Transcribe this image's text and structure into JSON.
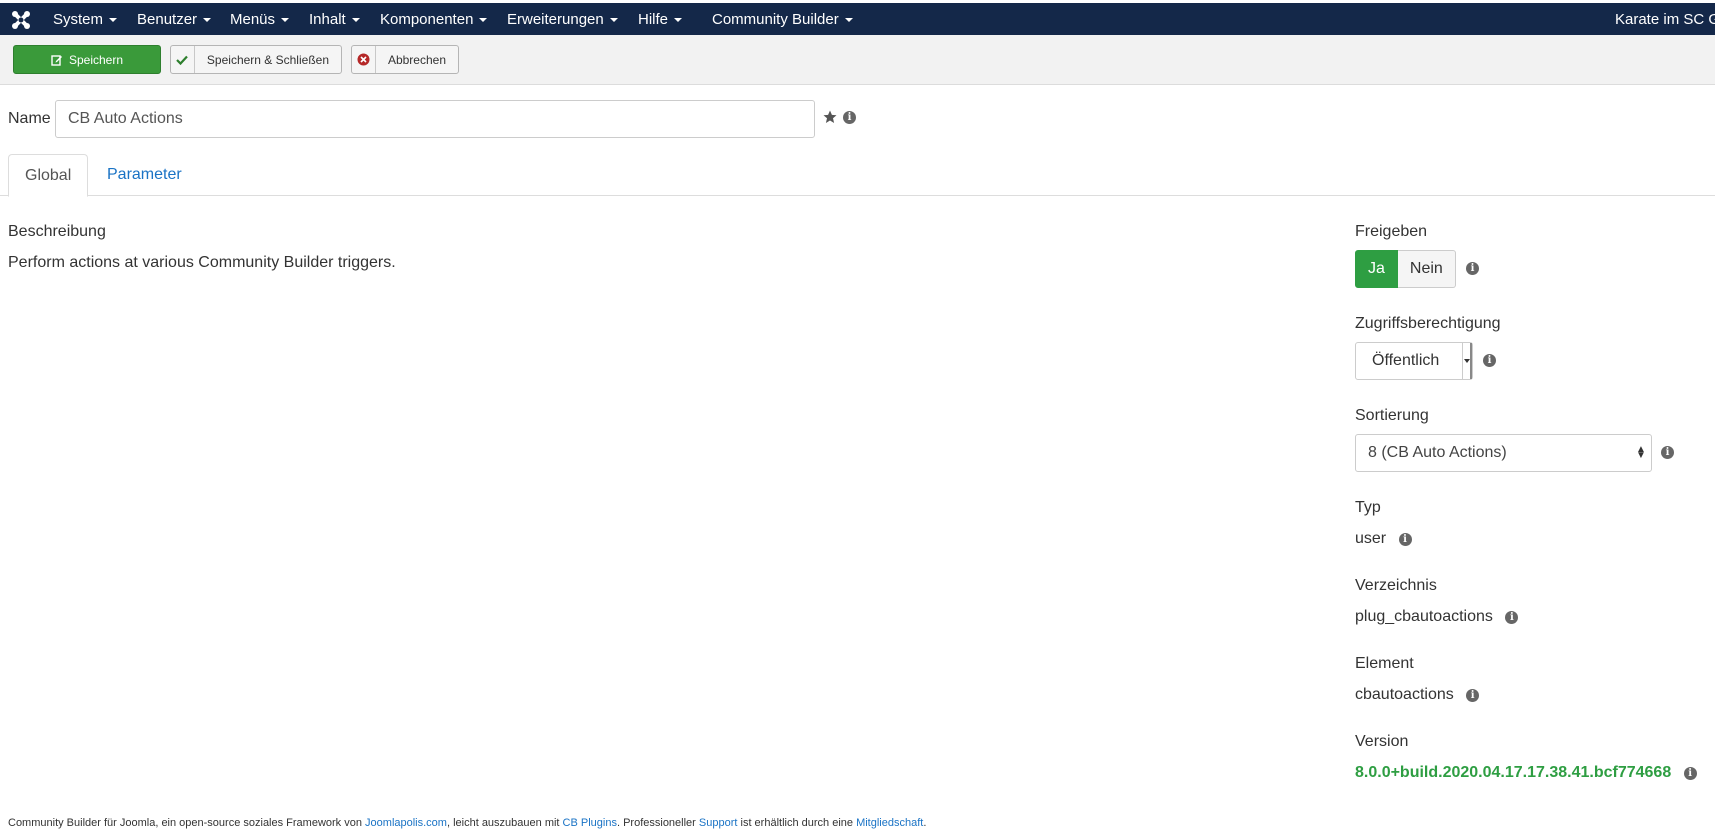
{
  "navbar": {
    "menus": [
      {
        "label": "System"
      },
      {
        "label": "Benutzer"
      },
      {
        "label": "Menüs"
      },
      {
        "label": "Inhalt"
      },
      {
        "label": "Komponenten"
      },
      {
        "label": "Erweiterungen"
      },
      {
        "label": "Hilfe"
      },
      {
        "label": "Community Builder"
      }
    ],
    "site_name": "Karate im SC G"
  },
  "toolbar": {
    "save_label": "Speichern",
    "save_close_label": "Speichern & Schließen",
    "cancel_label": "Abbrechen"
  },
  "name_field": {
    "label": "Name",
    "value": "CB Auto Actions"
  },
  "tabs": [
    {
      "label": "Global",
      "active": true
    },
    {
      "label": "Parameter",
      "active": false
    }
  ],
  "main": {
    "description_label": "Beschreibung",
    "description_text": "Perform actions at various Community Builder triggers."
  },
  "sidebar": {
    "enabled_label": "Freigeben",
    "enabled_yes": "Ja",
    "enabled_no": "Nein",
    "enabled_selected": "Ja",
    "access_label": "Zugriffsberechtigung",
    "access_value": "Öffentlich",
    "ordering_label": "Sortierung",
    "ordering_value": "8 (CB Auto Actions)",
    "type_label": "Typ",
    "type_value": "user",
    "folder_label": "Verzeichnis",
    "folder_value": "plug_cbautoactions",
    "element_label": "Element",
    "element_value": "cbautoactions",
    "version_label": "Version",
    "version_value": "8.0.0+build.2020.04.17.17.38.41.bcf774668"
  },
  "footer": {
    "text_1": "Community Builder für Joomla, ein open-source soziales Framework von ",
    "link_1": "Joomlapolis.com",
    "text_2": ", leicht auszubauen mit ",
    "link_2": "CB Plugins",
    "text_3": ". Professioneller ",
    "link_3": "Support",
    "text_4": " ist erhältlich durch eine ",
    "link_4": "Mitgliedschaft",
    "text_5": "."
  },
  "colors": {
    "navbar_bg": "#142849",
    "save_green": "#3a9a3a",
    "yes_green": "#2e9e42",
    "link_blue": "#1a73c5"
  }
}
